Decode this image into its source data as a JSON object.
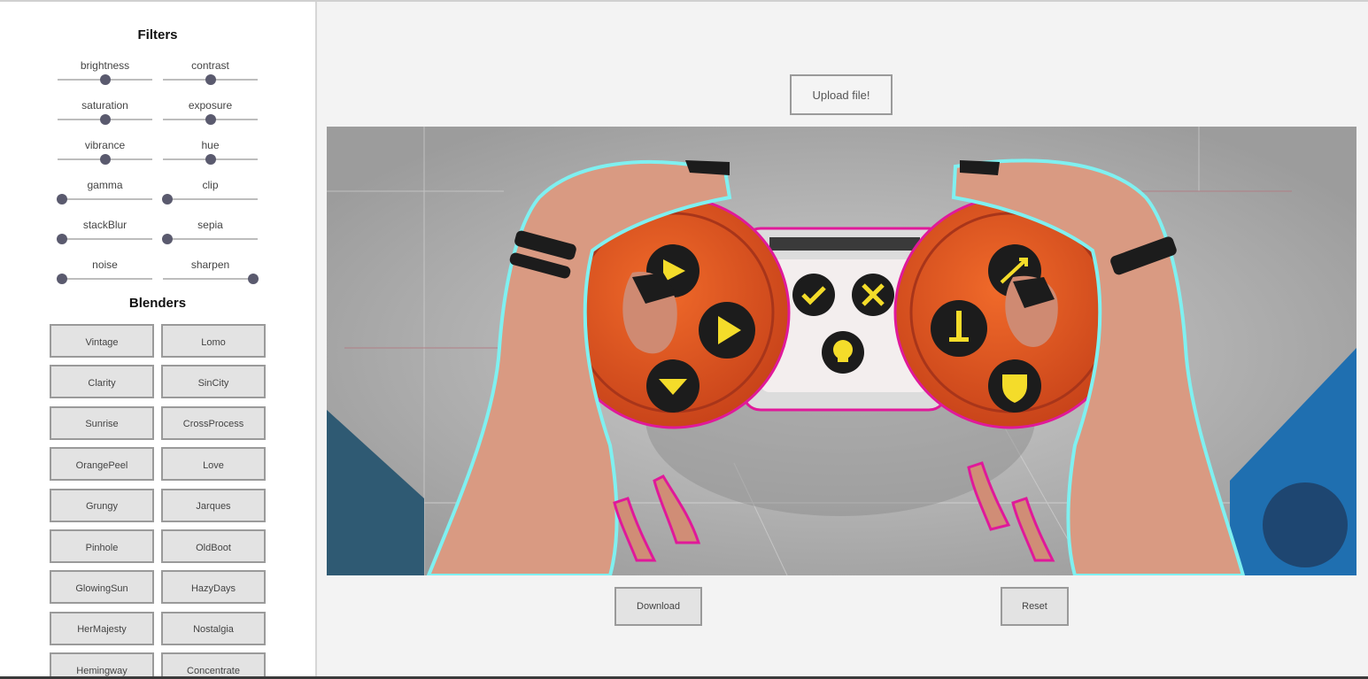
{
  "sidebar": {
    "filters_title": "Filters",
    "blenders_title": "Blenders",
    "filters": [
      {
        "label": "brightness",
        "value": 0.5
      },
      {
        "label": "contrast",
        "value": 0.5
      },
      {
        "label": "saturation",
        "value": 0.5
      },
      {
        "label": "exposure",
        "value": 0.5
      },
      {
        "label": "vibrance",
        "value": 0.5
      },
      {
        "label": "hue",
        "value": 0.5
      },
      {
        "label": "gamma",
        "value": 0.0
      },
      {
        "label": "clip",
        "value": 0.0
      },
      {
        "label": "stackBlur",
        "value": 0.0
      },
      {
        "label": "sepia",
        "value": 0.0
      },
      {
        "label": "noise",
        "value": 0.0
      },
      {
        "label": "sharpen",
        "value": 1.0
      }
    ],
    "blenders": [
      "Vintage",
      "Lomo",
      "Clarity",
      "SinCity",
      "Sunrise",
      "CrossProcess",
      "OrangePeel",
      "Love",
      "Grungy",
      "Jarques",
      "Pinhole",
      "OldBoot",
      "GlowingSun",
      "HazyDays",
      "HerMajesty",
      "Nostalgia",
      "Hemingway",
      "Concentrate"
    ]
  },
  "main": {
    "upload_label": "Upload file!",
    "download_label": "Download",
    "reset_label": "Reset",
    "image": {
      "subject": "hands holding orange game controller",
      "icons": [
        "triangle-icon",
        "play-icon",
        "chevron-icon",
        "check-icon",
        "cross-icon",
        "skull-icon",
        "arrow-icon",
        "sword-icon",
        "shield-icon"
      ]
    }
  },
  "colors": {
    "controller": "#e2541f",
    "button_dark": "#1c1c1c",
    "button_icon": "#f4dc2a",
    "skin": "#d99a82",
    "outline_cyan": "#7ff0f0",
    "outline_magenta": "#e0199a",
    "blue_panel": "#1f6fb0",
    "teal_panel": "#2f5a73"
  }
}
